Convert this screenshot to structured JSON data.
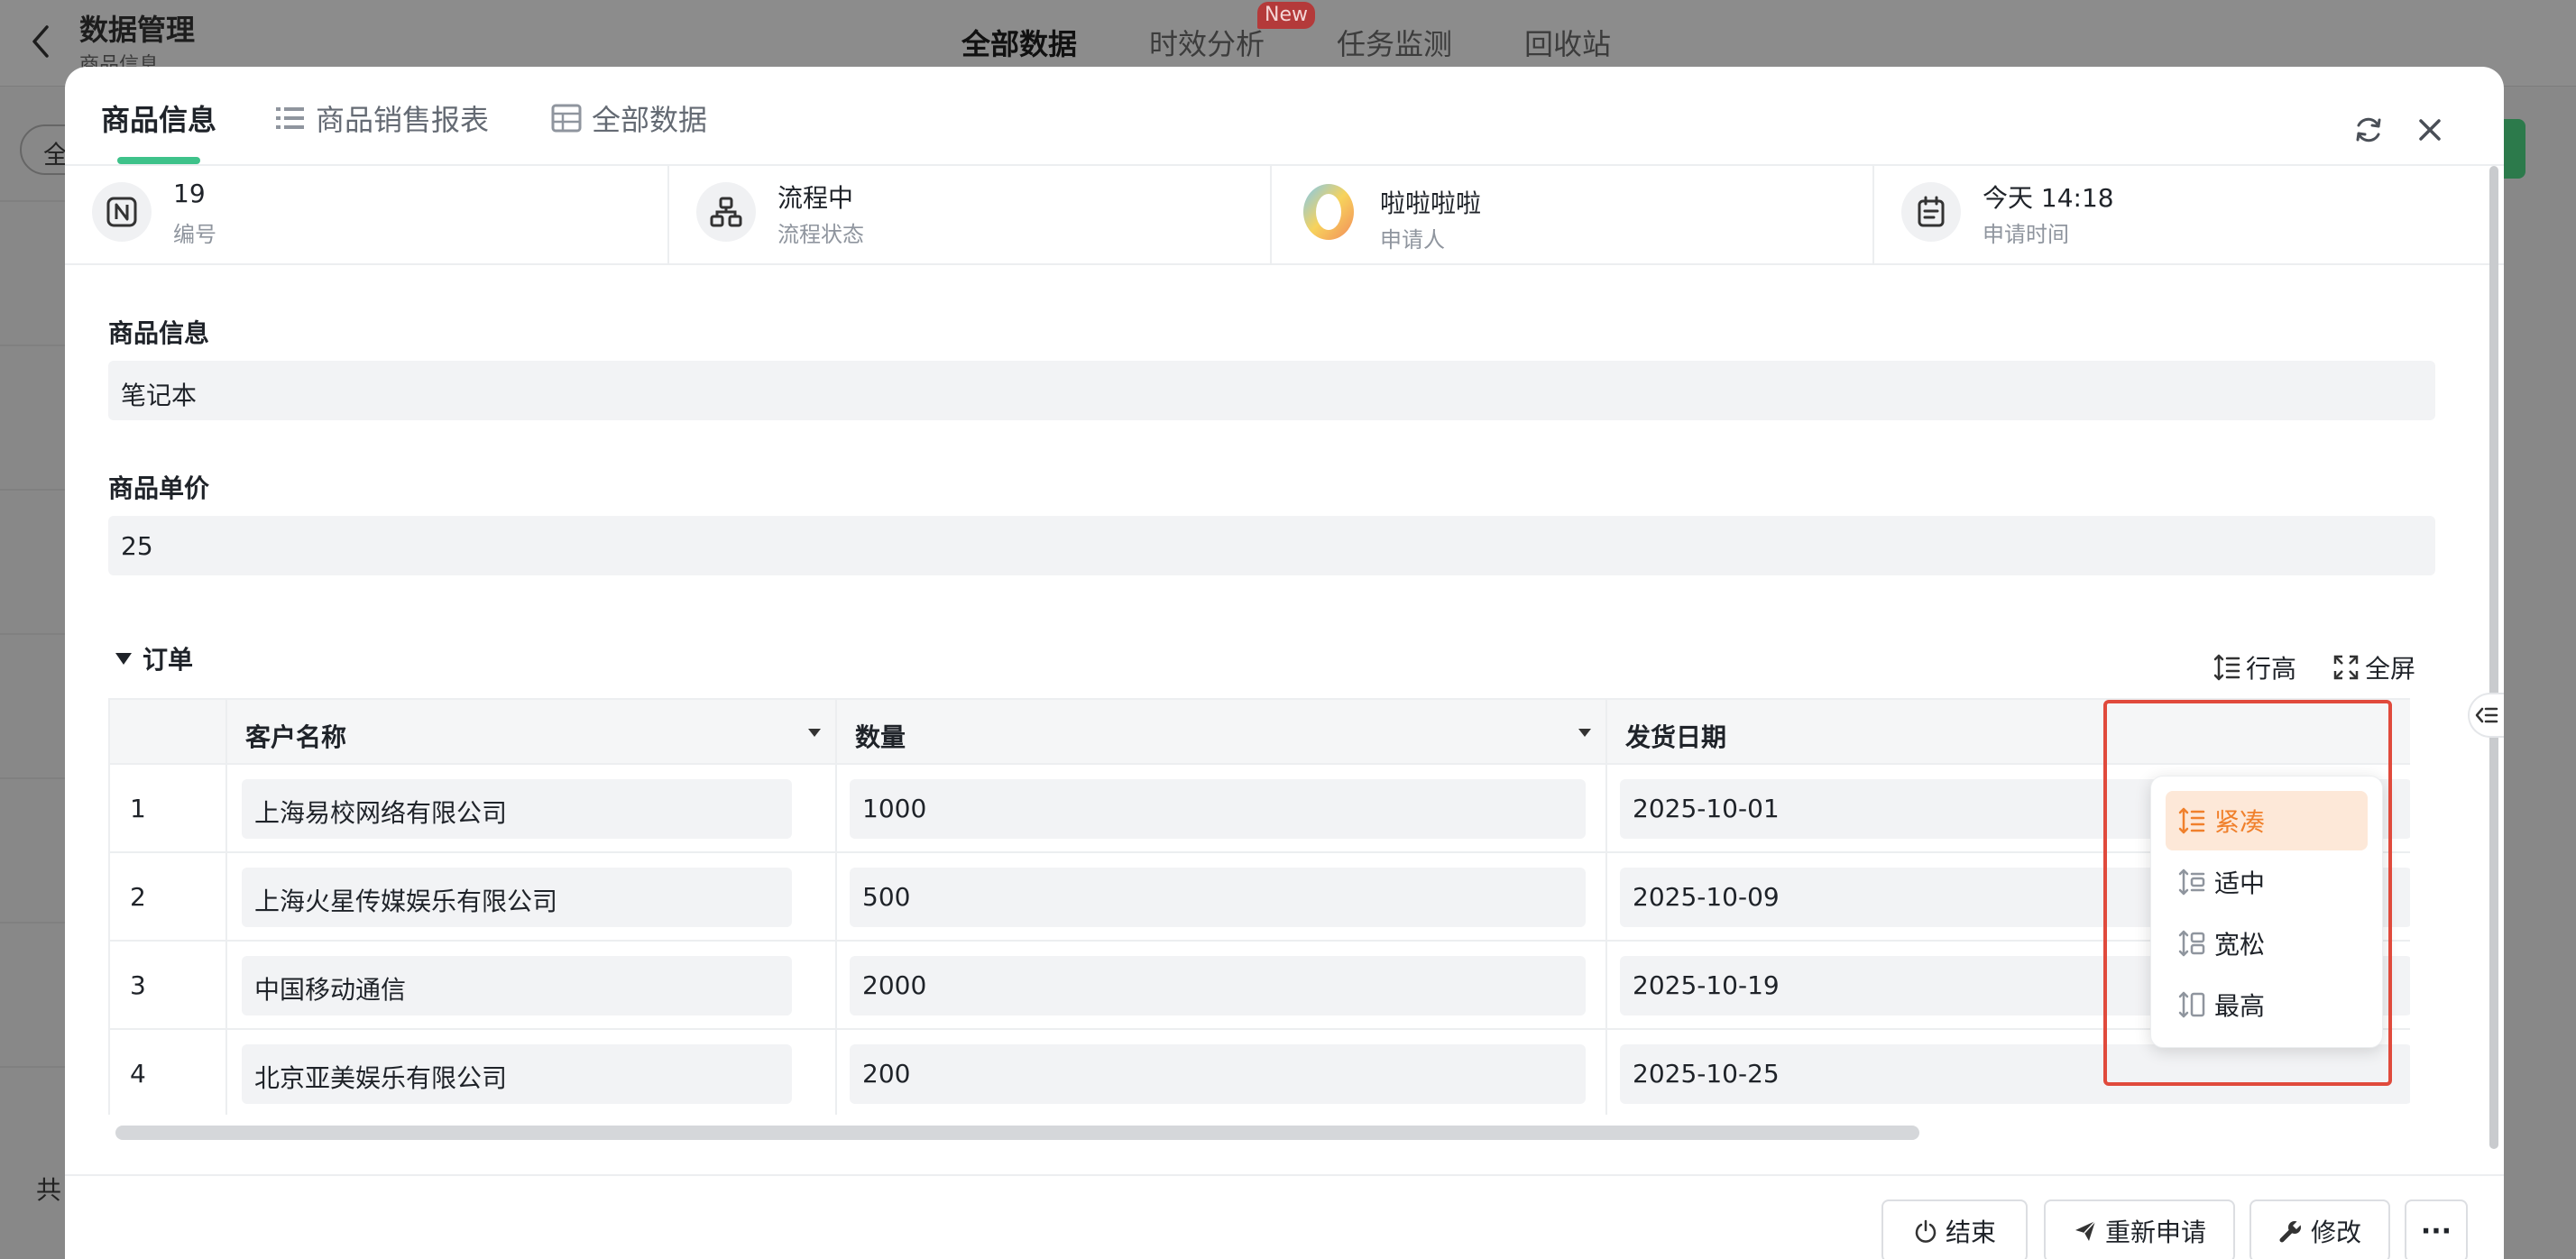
{
  "app": {
    "title": "数据管理",
    "subtitle": "商品信息",
    "nav_tabs": [
      {
        "label": "全部数据",
        "active": true
      },
      {
        "label": "时效分析",
        "badge": "New"
      },
      {
        "label": "任务监测"
      },
      {
        "label": "回收站"
      }
    ],
    "left_pill": "全",
    "footer_text": "共"
  },
  "modal": {
    "tabs": [
      {
        "label": "商品信息",
        "icon": "none",
        "active": true
      },
      {
        "label": "商品销售报表",
        "icon": "list-icon"
      },
      {
        "label": "全部数据",
        "icon": "table-icon"
      }
    ],
    "info": [
      {
        "value": "19",
        "label": "编号",
        "icon": "number-icon"
      },
      {
        "value": "流程中",
        "label": "流程状态",
        "icon": "flow-icon"
      },
      {
        "value": "啦啦啦啦",
        "label": "申请人",
        "icon": "avatar"
      },
      {
        "value": "今天 14:18",
        "label": "申请时间",
        "icon": "calendar-icon"
      }
    ],
    "fields": [
      {
        "label": "商品信息",
        "value": "笔记本"
      },
      {
        "label": "商品单价",
        "value": "25"
      }
    ],
    "order_section": {
      "title": "订单",
      "row_height_label": "行高",
      "fullscreen_label": "全屏",
      "columns": [
        "客户名称",
        "数量",
        "发货日期"
      ],
      "rows": [
        {
          "index": "1",
          "customer": "上海易校网络有限公司",
          "qty": "1000",
          "date": "2025-10-01"
        },
        {
          "index": "2",
          "customer": "上海火星传媒娱乐有限公司",
          "qty": "500",
          "date": "2025-10-09"
        },
        {
          "index": "3",
          "customer": "中国移动通信",
          "qty": "2000",
          "date": "2025-10-19"
        },
        {
          "index": "4",
          "customer": "北京亚美娱乐有限公司",
          "qty": "200",
          "date": "2025-10-25"
        }
      ],
      "row_height_options": [
        {
          "label": "紧凑",
          "selected": true
        },
        {
          "label": "适中"
        },
        {
          "label": "宽松"
        },
        {
          "label": "最高"
        }
      ]
    },
    "actions": {
      "end": "结束",
      "reapply": "重新申请",
      "edit": "修改",
      "more": "···"
    }
  },
  "colors": {
    "accent_green": "#3ec28a",
    "selected_orange": "#f0802c",
    "selected_bg": "#fde8d8",
    "highlight_red": "#e04a3c",
    "new_badge": "#b43a3a"
  }
}
